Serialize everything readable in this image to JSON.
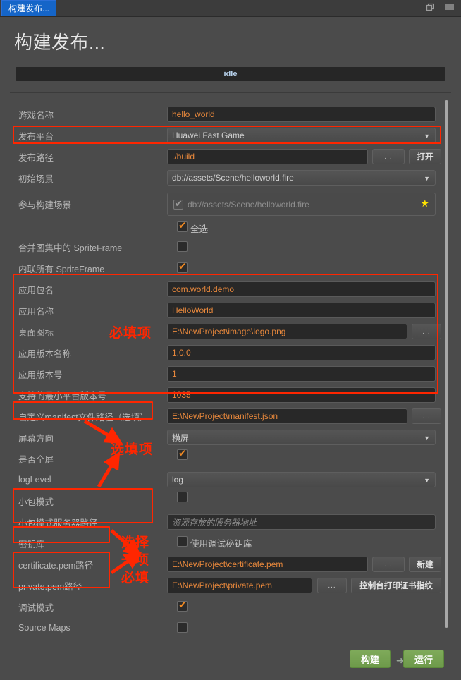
{
  "window": {
    "tab_title": "构建发布...",
    "restore_icon": "restore-window-icon",
    "menu_icon": "hamburger-menu-icon"
  },
  "page": {
    "heading": "构建发布...",
    "status": "idle"
  },
  "form": {
    "rows": [
      {
        "label": "游戏名称",
        "value": "hello_world"
      },
      {
        "label": "发布平台",
        "value": "Huawei Fast Game"
      },
      {
        "label": "发布路径",
        "value": "./build",
        "browse": "...",
        "action": "打开"
      },
      {
        "label": "初始场景",
        "value": "db://assets/Scene/helloworld.fire"
      },
      {
        "label": "参与构建场景",
        "value": "db://assets/Scene/helloworld.fire"
      },
      {
        "label": "全选"
      },
      {
        "label": "合并图集中的 SpriteFrame"
      },
      {
        "label": "内联所有 SpriteFrame"
      },
      {
        "label": "应用包名",
        "value": "com.world.demo"
      },
      {
        "label": "应用名称",
        "value": "HelloWorld"
      },
      {
        "label": "桌面图标",
        "value": "E:\\NewProject\\image\\logo.png",
        "browse": "..."
      },
      {
        "label": "应用版本名称",
        "value": "1.0.0"
      },
      {
        "label": "应用版本号",
        "value": "1"
      },
      {
        "label": "支持的最小平台版本号",
        "value": "1035"
      },
      {
        "label": "自定义manifest文件路径（选填）",
        "value": "E:\\NewProject\\manifest.json",
        "browse": "..."
      },
      {
        "label": "屏幕方向",
        "value": "横屏"
      },
      {
        "label": "是否全屏"
      },
      {
        "label": "logLevel",
        "value": "log"
      },
      {
        "label": "小包模式"
      },
      {
        "label": "小包模式服务器路径",
        "placeholder": "资源存放的服务器地址"
      },
      {
        "label": "密钥库",
        "checkbox_text": "使用调试秘钥库"
      },
      {
        "label": "certificate.pem路径",
        "value": "E:\\NewProject\\certificate.pem",
        "browse": "...",
        "action": "新建"
      },
      {
        "label": "private.pem路径",
        "value": "E:\\NewProject\\private.pem",
        "browse": "...",
        "action": "控制台打印证书指纹"
      },
      {
        "label": "调试模式"
      },
      {
        "label": "Source Maps"
      }
    ]
  },
  "annotations": {
    "required": "必填项",
    "optional": "选填项",
    "choose_one": "选择\n一项\n必填",
    "choose_one_l1": "选择",
    "choose_one_l2": "一项",
    "choose_one_l3": "必填",
    "color": "#ff2600"
  },
  "footer": {
    "build": "构建",
    "arrow": "➜",
    "run": "运行"
  }
}
